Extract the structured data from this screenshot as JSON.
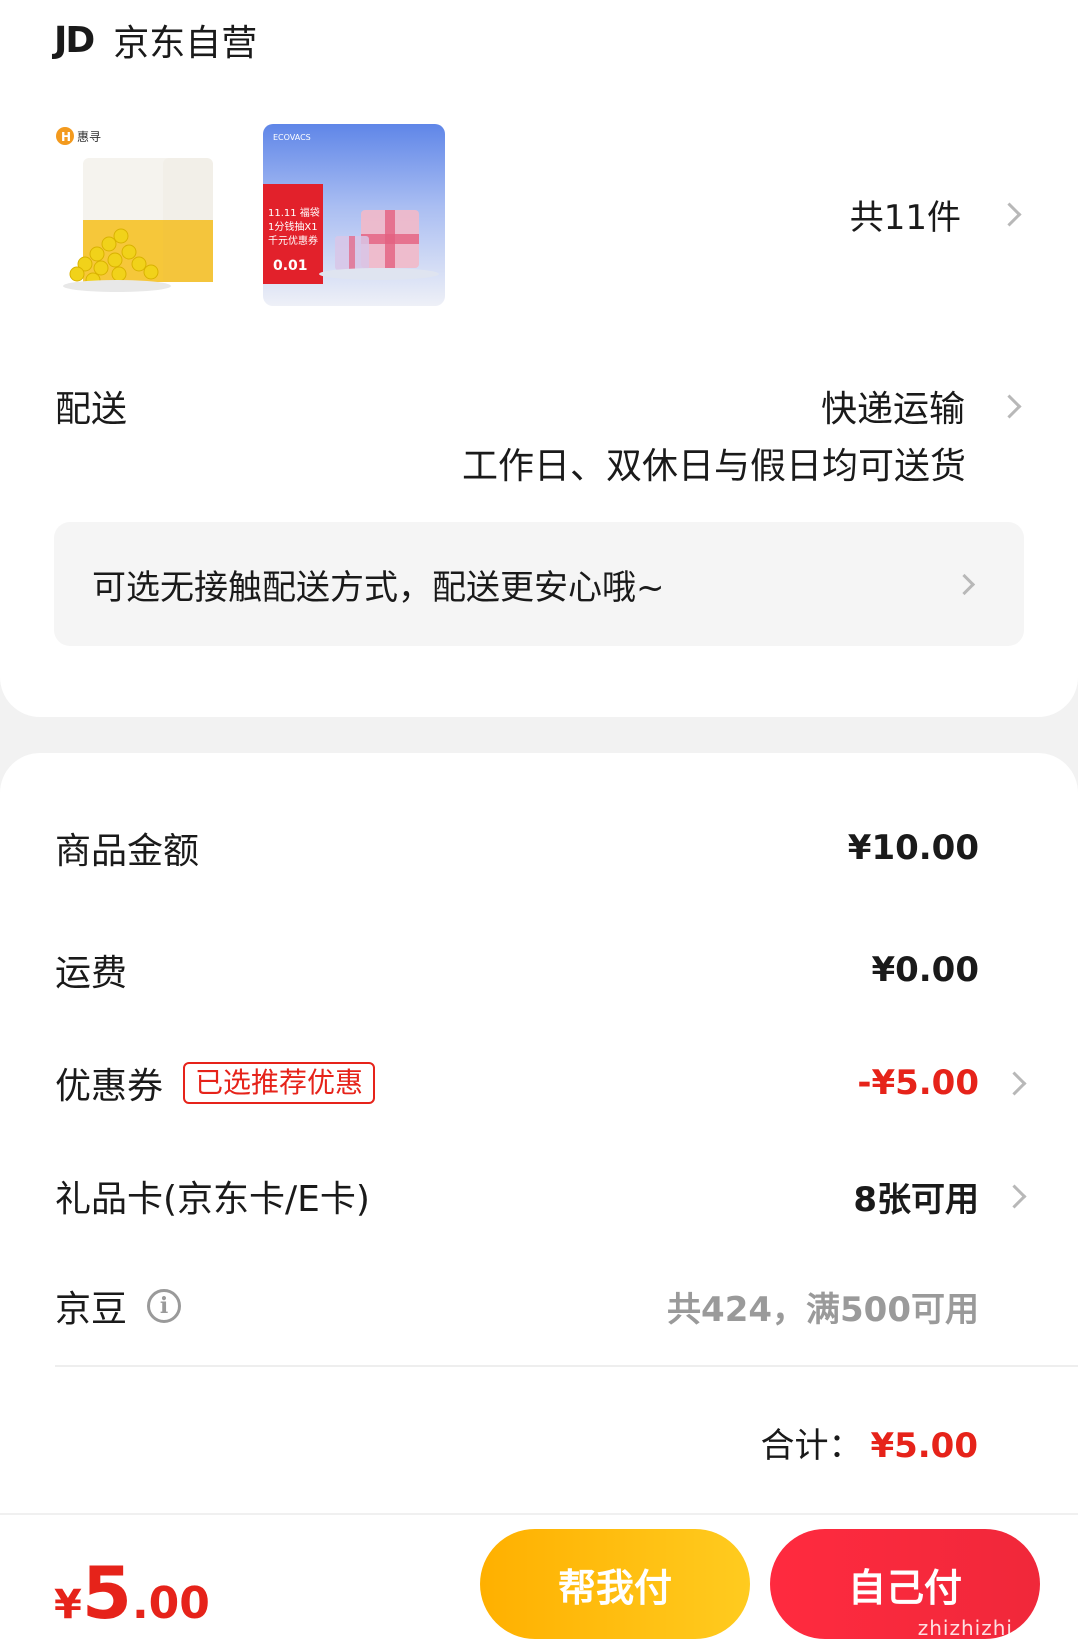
{
  "shop": {
    "logo": "JD",
    "name": "京东自营"
  },
  "products": {
    "count_label": "共11件",
    "item2_lines": [
      "11.11 福袋",
      "1分钱抽X1",
      "千元优惠券"
    ],
    "item2_price": "0.01",
    "item2_brand": "ECOVACS",
    "item1_brand": "惠寻"
  },
  "delivery": {
    "label": "配送",
    "method": "快递运输",
    "note": "工作日、双休日与假日均可送货",
    "contactless": "可选无接触配送方式，配送更安心哦~"
  },
  "fees": {
    "goods_label": "商品金额",
    "goods_value": "¥10.00",
    "shipping_label": "运费",
    "shipping_value": "¥0.00",
    "coupon_label": "优惠券",
    "coupon_tag": "已选推荐优惠",
    "coupon_value": "-¥5.00",
    "giftcard_label": "礼品卡(京东卡/E卡)",
    "giftcard_value": "8张可用",
    "jingdou_label": "京豆",
    "jingdou_value": "共424，满500可用",
    "total_label": "合计：",
    "total_value": "¥5.00"
  },
  "bottom": {
    "pay_symbol": "¥",
    "pay_int": "5",
    "pay_dec": ".00",
    "help_pay": "帮我付",
    "self_pay": "自己付",
    "watermark": "zhizhizhi.com"
  },
  "colors": {
    "accent_red": "#e6231a",
    "help_yellow": "#ffb000",
    "pay_red": "#ff2a3f"
  }
}
